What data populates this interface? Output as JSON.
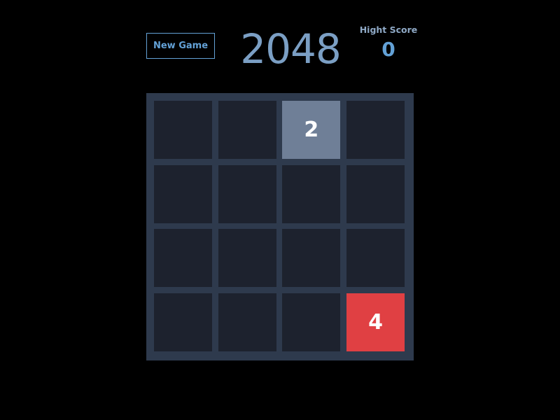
{
  "header": {
    "new_game_label": "New Game",
    "title": "2048",
    "high_score_label": "Hight Score",
    "high_score_value": "0"
  },
  "board": {
    "size": 4,
    "tiles": [
      {
        "row": 0,
        "col": 2,
        "value": "2",
        "color": "#6f7f97"
      },
      {
        "row": 3,
        "col": 3,
        "value": "4",
        "color": "#e04043"
      }
    ]
  },
  "colors": {
    "background": "#000000",
    "board": "#2e3a4d",
    "empty_cell": "#1d222e",
    "accent": "#63a1d6",
    "title": "#7b9fc4"
  }
}
